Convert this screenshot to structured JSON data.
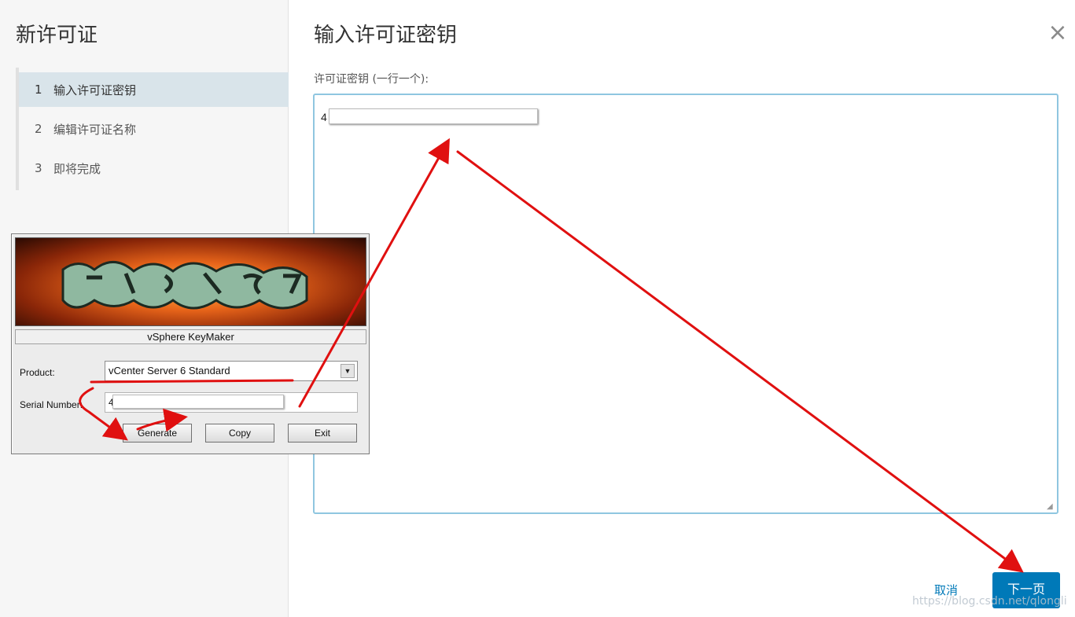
{
  "wizard": {
    "title": "新许可证",
    "steps": [
      {
        "num": "1",
        "label": "输入许可证密钥"
      },
      {
        "num": "2",
        "label": "编辑许可证名称"
      },
      {
        "num": "3",
        "label": "即将完成"
      }
    ],
    "active_step": 1
  },
  "main": {
    "title": "输入许可证密钥",
    "close_icon": "×",
    "field_label": "许可证密钥 (一行一个):",
    "license_key_visible": "4",
    "resize_icon": "◢"
  },
  "footer": {
    "cancel_label": "取消",
    "next_label": "下一页"
  },
  "watermark": "https://blog.csdn.net/qlongli",
  "keymaker": {
    "title": "vSphere KeyMaker",
    "banner_icon": "graffiti-logo",
    "product_label": "Product:",
    "product_value": "vCenter Server 6 Standard",
    "dropdown_icon": "▼",
    "serial_label": "Serial Number:",
    "serial_visible": "4",
    "generate_label": "Generate",
    "copy_label": "Copy",
    "exit_label": "Exit"
  },
  "colors": {
    "accent": "#0079b8",
    "textarea_border": "#8fc6e0",
    "active_step_bg": "#d9e4ea",
    "annotation": "#e01010"
  }
}
